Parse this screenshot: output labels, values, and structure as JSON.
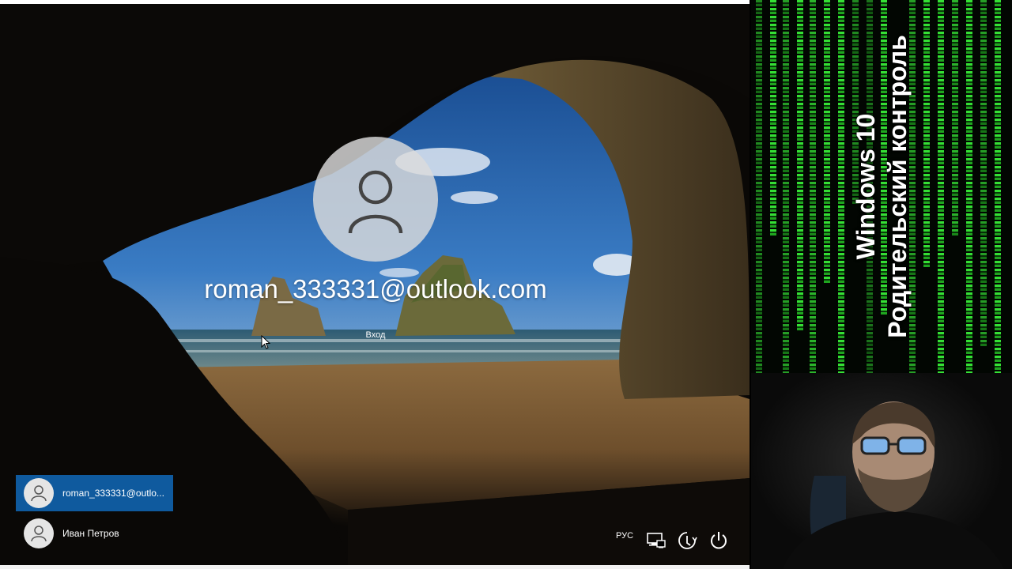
{
  "lockscreen": {
    "account_name": "roman_333331@outlook.com",
    "signin_label": "Вход",
    "avatar_icon": "user-icon"
  },
  "user_list": [
    {
      "label": "roman_333331@outlo...",
      "icon": "user-icon",
      "selected": true
    },
    {
      "label": "Иван Петров",
      "icon": "user-icon",
      "selected": false
    }
  ],
  "system_tray": {
    "language": "РУС",
    "icons": [
      "network-icon",
      "ease-of-access-icon",
      "power-icon"
    ]
  },
  "title_panel": {
    "line1": "Windows 10",
    "line2": "Родительский контроль"
  },
  "colors": {
    "selected_tile": "#0f5a9e",
    "matrix_green": "#35e035"
  }
}
